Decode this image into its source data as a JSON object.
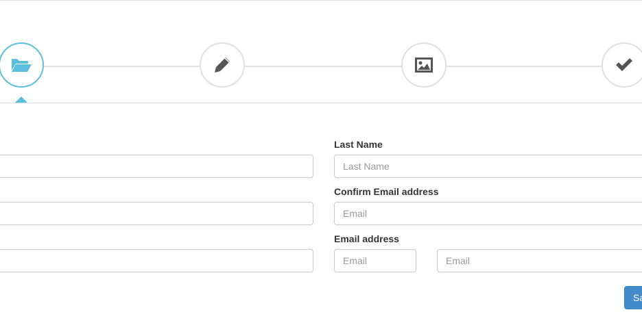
{
  "wizard": {
    "steps": [
      {
        "icon": "folder-open-icon",
        "active": true
      },
      {
        "icon": "pencil-icon",
        "active": false
      },
      {
        "icon": "picture-icon",
        "active": false
      },
      {
        "icon": "checkmark-icon",
        "active": false
      }
    ],
    "colors": {
      "active": "#5bc0de",
      "inactive_border": "#e0e0e0",
      "icon": "#555555"
    }
  },
  "form": {
    "last_name": {
      "label": "Last Name",
      "placeholder": "Last Name",
      "value": ""
    },
    "confirm_email": {
      "label": "Confirm Email address",
      "placeholder": "Email",
      "value": ""
    },
    "email_address": {
      "label": "Email address",
      "placeholder_left": "Email",
      "placeholder_right": "Email"
    },
    "left_column": {
      "input_1": {
        "value": ""
      },
      "input_2": {
        "value": ""
      },
      "input_3": {
        "value": ""
      }
    }
  },
  "actions": {
    "save_label": "Save",
    "save_color": "#428bca"
  }
}
